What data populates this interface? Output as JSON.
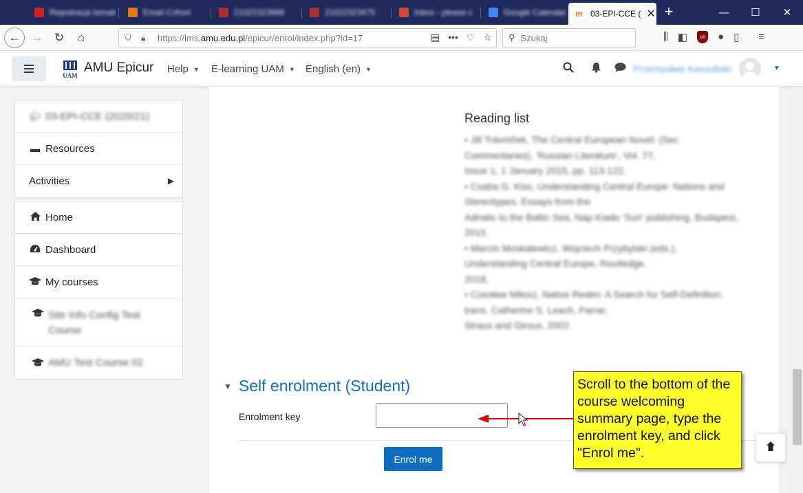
{
  "browser": {
    "tabs": [
      {
        "label": "Rejestracja tematów",
        "favicon_color": "#d42020"
      },
      {
        "label": "Email Cohort",
        "favicon_color": "#e07a10"
      },
      {
        "label": "21022323866",
        "favicon_color": "#aa3030"
      },
      {
        "label": "21022323475",
        "favicon_color": "#aa3030"
      },
      {
        "label": "Inbox - please c",
        "favicon_color": "#d44638"
      },
      {
        "label": "Google Calendar",
        "favicon_color": "#4285f4"
      }
    ],
    "active_tab": {
      "label": "03-EPI-CCE (",
      "favicon_color": "#f98012"
    },
    "new_tab_icon": "plus-icon",
    "url_host_prefix": "https://lms.",
    "url_host": "amu.edu.pl",
    "url_path": "/epicur/enrol/index.php?id=17",
    "search_placeholder": "Szukaj"
  },
  "header": {
    "site_name": "AMU Epicur",
    "menus": [
      "Help",
      "E-learning UAM",
      "English (en)"
    ],
    "user_name": "Przemysław Kaszubski"
  },
  "sidebar": {
    "course_items": [
      {
        "label": "03-EPI-CCE (2020/21)",
        "icon": "graduation-cap-icon",
        "blurred": true
      },
      {
        "label": "Resources",
        "icon": "archive-icon"
      },
      {
        "label": "Activities",
        "icon": "",
        "has_arrow": true
      }
    ],
    "nav_items": [
      {
        "label": "Home",
        "icon": "home-icon"
      },
      {
        "label": "Dashboard",
        "icon": "dashboard-icon"
      },
      {
        "label": "My courses",
        "icon": "graduation-cap-icon"
      },
      {
        "label": "Site Info Config Test Course",
        "icon": "graduation-cap-icon",
        "blurred": true
      },
      {
        "label": "AMU Test Course 02",
        "icon": "graduation-cap-icon",
        "blurred": true
      }
    ]
  },
  "main": {
    "reading_title": "Reading list",
    "reading_lines": [
      "•   Jill Trávníček, The Central European Novel: (Sec",
      "Commentaries), ‘Russian Literature’, Vol. 77,",
      "Issue 1, 1 January 2015, pp. 113-122.",
      "•   Csaba G. Kiss, Understanding Central Europe: Nations and",
      "Stereotypes. Essays from the",
      "Adriatic to the Baltic Sea, Nap Kiado ‘Sun’ publishing, Budapest,",
      "2015.",
      "•   Marcin Moskalewicz, Wojciech Przybylski (eds.),",
      "Understanding Central Europe, Routledge,",
      "2018.",
      "•   Czesław Miłosz, Native Realm: A Search for Self-Definition,",
      "trans. Catherine S. Leach, Farrar,",
      "Straus and Giroux, 2002."
    ],
    "section_title": "Self enrolment (Student)",
    "enrolment_key_label": "Enrolment key",
    "enrolment_key_value": "",
    "enrol_button": "Enrol me"
  },
  "annotation": {
    "text": "Scroll to the bottom of the course welcoming summary page, type the enrolment key, and click \"Enrol me\".",
    "bg_color": "#ffff2e",
    "arrow_color": "#e00000"
  },
  "colors": {
    "tabstrip": "#1f2b5e",
    "primary": "#0f6cbf"
  }
}
